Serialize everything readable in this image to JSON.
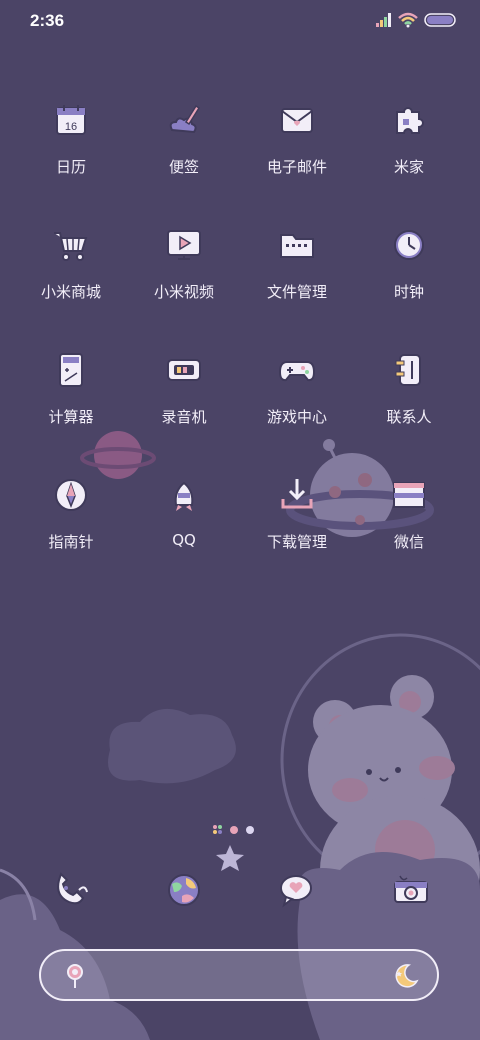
{
  "status_bar": {
    "time": "2:36"
  },
  "apps": [
    {
      "label": "日历",
      "icon": "calendar-icon",
      "date": "16"
    },
    {
      "label": "便签",
      "icon": "notes-icon"
    },
    {
      "label": "电子邮件",
      "icon": "email-icon"
    },
    {
      "label": "米家",
      "icon": "puzzle-icon"
    },
    {
      "label": "小米商城",
      "icon": "shopping-cart-icon"
    },
    {
      "label": "小米视频",
      "icon": "video-icon"
    },
    {
      "label": "文件管理",
      "icon": "folder-icon"
    },
    {
      "label": "时钟",
      "icon": "clock-icon"
    },
    {
      "label": "计算器",
      "icon": "calculator-icon"
    },
    {
      "label": "录音机",
      "icon": "recorder-icon"
    },
    {
      "label": "游戏中心",
      "icon": "gamepad-icon"
    },
    {
      "label": "联系人",
      "icon": "contacts-icon"
    },
    {
      "label": "指南针",
      "icon": "compass-icon"
    },
    {
      "label": "QQ",
      "icon": "qq-icon"
    },
    {
      "label": "下载管理",
      "icon": "download-icon"
    },
    {
      "label": "微信",
      "icon": "wechat-icon"
    }
  ],
  "dock": [
    {
      "icon": "phone-icon"
    },
    {
      "icon": "browser-icon"
    },
    {
      "icon": "messages-icon"
    },
    {
      "icon": "camera-icon"
    }
  ],
  "search": {
    "left_icon": "lollipop-icon",
    "right_icon": "moon-icon"
  },
  "colors": {
    "background": "#4b4466",
    "icon_fill": "#f2eef8",
    "icon_stroke": "#3f3a5a",
    "accent_pink": "#e8a4b8",
    "accent_purple": "#8a7fc4"
  }
}
